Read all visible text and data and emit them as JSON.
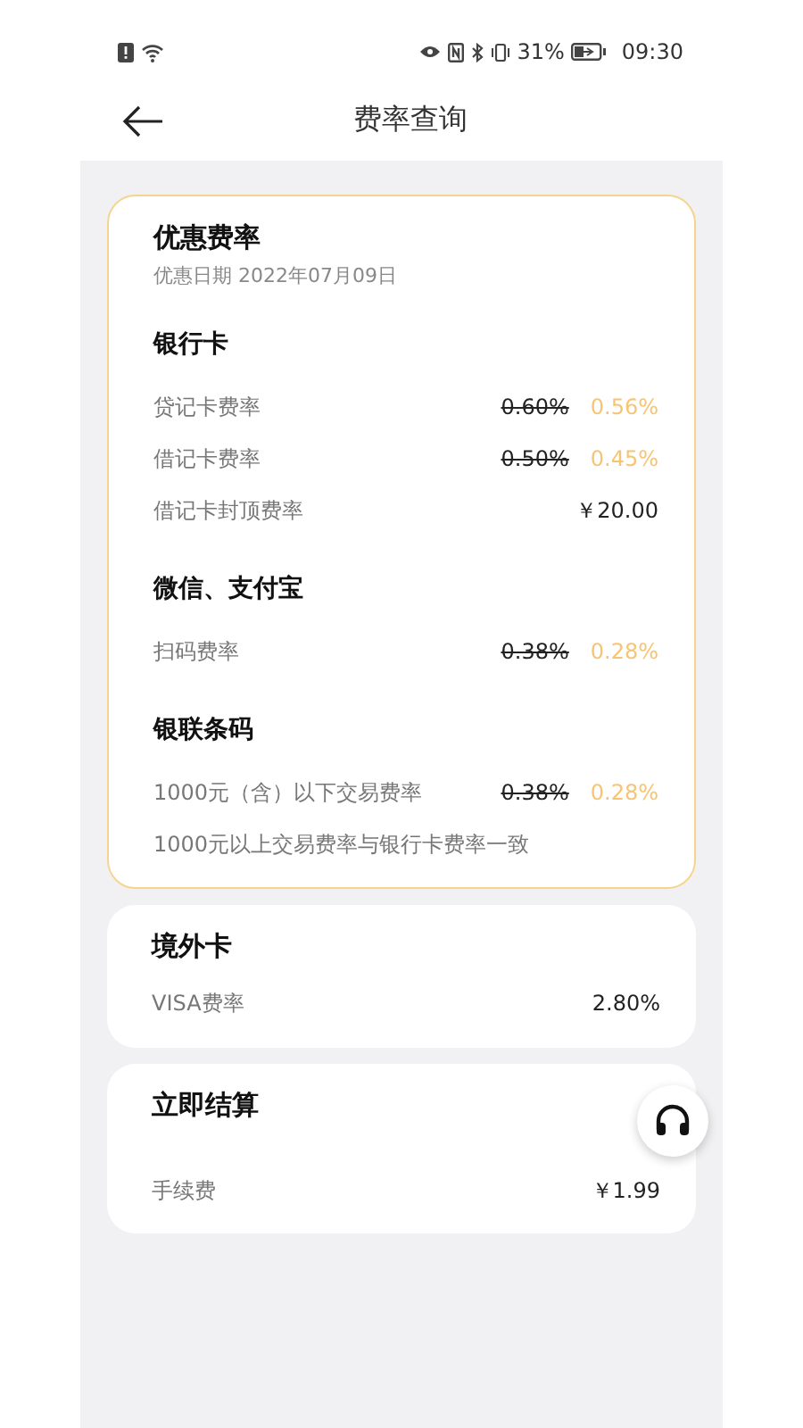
{
  "status_bar": {
    "battery": "31%",
    "time": "09:30"
  },
  "header": {
    "title": "费率查询"
  },
  "cards": [
    {
      "highlighted": true,
      "title": "优惠费率",
      "subtitle": "优惠日期 2022年07月09日",
      "sections": [
        {
          "heading": "银行卡",
          "rows": [
            {
              "kind": "promo",
              "label": "贷记卡费率",
              "old": "0.60%",
              "value": "0.56%"
            },
            {
              "kind": "promo",
              "label": "借记卡费率",
              "old": "0.50%",
              "value": "0.45%"
            },
            {
              "kind": "plain",
              "label": "借记卡封顶费率",
              "value": "￥20.00"
            }
          ]
        },
        {
          "heading": "微信、支付宝",
          "rows": [
            {
              "kind": "promo",
              "label": "扫码费率",
              "old": "0.38%",
              "value": "0.28%"
            }
          ]
        },
        {
          "heading": "银联条码",
          "rows": [
            {
              "kind": "promo",
              "label": "1000元（含）以下交易费率",
              "old": "0.38%",
              "value": "0.28%"
            },
            {
              "kind": "note",
              "label": "1000元以上交易费率与银行卡费率一致"
            }
          ]
        }
      ]
    },
    {
      "highlighted": false,
      "title": "境外卡",
      "sections": [
        {
          "rows": [
            {
              "kind": "plain",
              "label": "VISA费率",
              "value": "2.80%"
            }
          ]
        }
      ]
    },
    {
      "highlighted": false,
      "title": "立即结算",
      "sections": [
        {
          "rows": [
            {
              "kind": "plain",
              "label": "手续费",
              "value": "￥1.99"
            }
          ]
        }
      ]
    }
  ]
}
